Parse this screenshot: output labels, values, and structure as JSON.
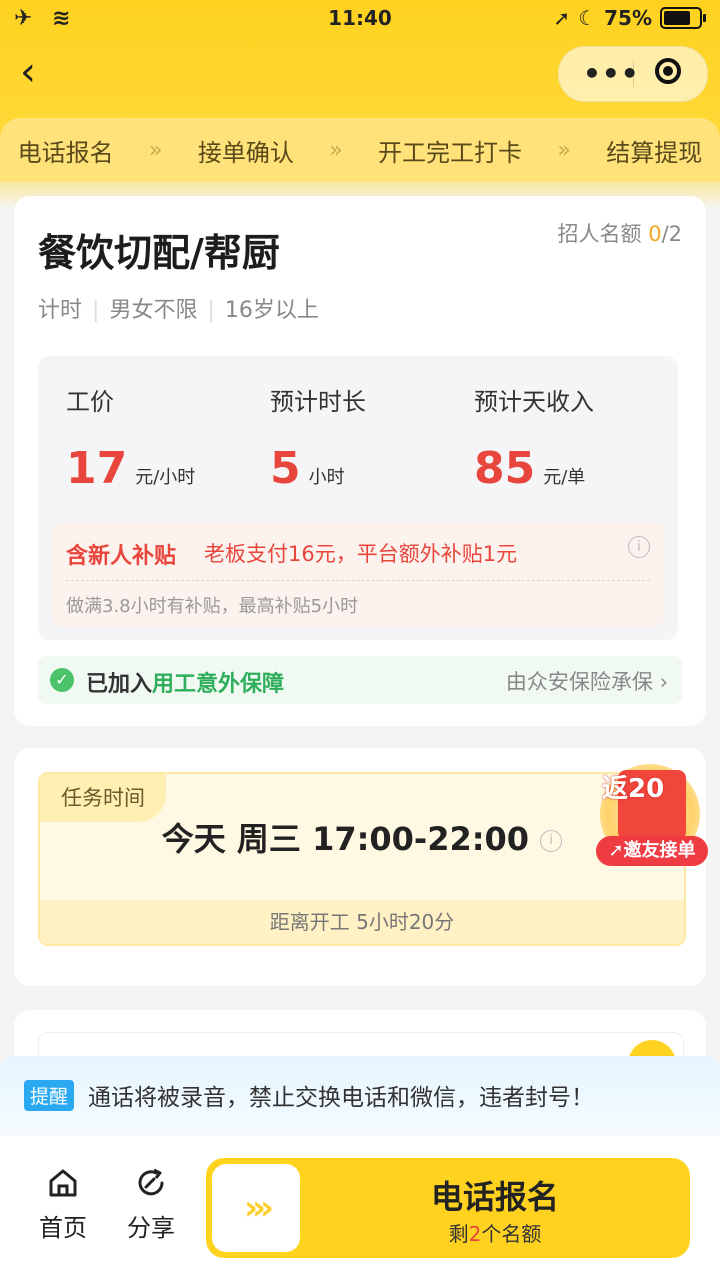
{
  "status": {
    "time": "11:40",
    "battery": "75%"
  },
  "steps": [
    "电话报名",
    "接单确认",
    "开工完工打卡",
    "结算提现"
  ],
  "job": {
    "title": "餐饮切配/帮厨",
    "quota_label": "招人名额",
    "quota_filled": "0",
    "quota_total": "/2",
    "tags": [
      "计时",
      "男女不限",
      "16岁以上"
    ]
  },
  "pay": {
    "price_label": "工价",
    "price_value": "17",
    "price_unit": "元/小时",
    "duration_label": "预计时长",
    "duration_value": "5",
    "duration_unit": "小时",
    "income_label": "预计天收入",
    "income_value": "85",
    "income_unit": "元/单"
  },
  "subsidy": {
    "heading": "含新人补贴",
    "detail": "老板支付16元，平台额外补贴1元",
    "note": "做满3.8小时有补贴，最高补贴5小时"
  },
  "insurance": {
    "prefix": "已加入",
    "highlight": "用工意外保障",
    "provider": "由众安保险承保"
  },
  "task": {
    "tag": "任务时间",
    "time": "今天 周三 17:00-22:00",
    "countdown": "距离开工 5小时20分"
  },
  "promo": {
    "amount": "返20",
    "label": "邀友接单"
  },
  "notice": {
    "tag": "提醒",
    "text": "通话将被录音，禁止交换电话和微信，违者封号！"
  },
  "bottom": {
    "home": "首页",
    "share": "分享",
    "cta_main": "电话报名",
    "cta_sub_prefix": "剩",
    "cta_sub_count": "2",
    "cta_sub_suffix": "个名额"
  },
  "colors": {
    "brand": "#ffd21f",
    "price": "#e8453c",
    "insurance": "#2fae5b"
  }
}
